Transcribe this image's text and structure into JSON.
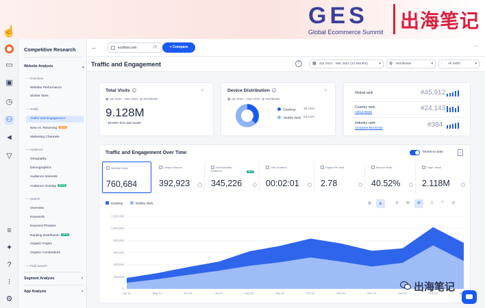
{
  "banner": {
    "ges": "GES",
    "subtitle": "Global Ecommerce Summit",
    "chinese": "出海笔记"
  },
  "sidebar": {
    "title": "Competitive Research",
    "sections": [
      {
        "label": "Website Analysis"
      },
      {
        "label": "Segment Analysis"
      },
      {
        "label": "App Analysis"
      }
    ],
    "groups": [
      "Overview",
      "Traffic",
      "Audience",
      "Search",
      "Paid Search"
    ],
    "items": {
      "website_performance": "Website Performance",
      "similar_sites": "Similar Sites",
      "traffic_engagement": "Traffic and Engagement",
      "new_returning": "New vs. Returning",
      "new_returning_badge": "NEW",
      "marketing_channels": "Marketing Channels",
      "geography": "Geography",
      "demographics": "Demographics",
      "audience_interests": "Audience Interests",
      "audience_overlap": "Audience Overlap",
      "audience_overlap_badge": "BETA",
      "search_overview": "Overview",
      "keywords": "Keywords",
      "keyword_phrases": "Keyword Phrases",
      "ranking_distribution": "Ranking Distribution",
      "ranking_badge": "NEW",
      "organic_pages": "Organic Pages",
      "organic_competitors": "Organic Competitors"
    }
  },
  "topbar": {
    "domain": "ecoflow.com",
    "compare_label": "+ Compare"
  },
  "header": {
    "title": "Traffic and Engagement",
    "date_range": "Apr 2021 - Mar 2022 (12 Months)",
    "country": "Worldwide",
    "traffic": "All traffic"
  },
  "total_visits": {
    "title": "Total Visits",
    "date": "Apr 2021 - Mar 2022",
    "country": "Worldwide",
    "value": "9.128M",
    "change_pct": "50.98%",
    "change_text": "from last month"
  },
  "device": {
    "title": "Device Distribution",
    "date": "Apr 2021 - Mar 2022",
    "country": "Worldwide",
    "desktop_label": "Desktop",
    "desktop_pct": "36.76%",
    "mobile_label": "Mobile Web",
    "mobile_pct": "63.24%",
    "desktop_fraction": 0.3676,
    "colors": {
      "desktop": "#195af2",
      "mobile": "#8fb3f7"
    }
  },
  "ranks": {
    "global_label": "Global rank",
    "global_value": "#45,912",
    "country_label": "Country rank",
    "country_sub": "United States",
    "country_value": "#24,143",
    "industry_label": "Industry rank",
    "industry_sub": "Consumer Electronics",
    "industry_value": "#384"
  },
  "traffic_card": {
    "title": "Traffic and Engagement Over Time",
    "toggle_label": "Month-to-date",
    "metrics": [
      {
        "label": "Monthly Visits",
        "value": "760,684"
      },
      {
        "label": "Unique Visitors",
        "value": "392,923"
      },
      {
        "label": "Deduplicated Audience",
        "value": "345,226",
        "badge": "NEW"
      },
      {
        "label": "Visit Duration",
        "value": "00:02:01"
      },
      {
        "label": "Pages Per Visit",
        "value": "2.78"
      },
      {
        "label": "Bounce Rate",
        "value": "40.52%"
      },
      {
        "label": "Page Views",
        "value": "2.118M"
      }
    ],
    "legend": {
      "desktop": "Desktop",
      "mobile": "Mobile Web"
    },
    "granularity": [
      "D",
      "W",
      "M"
    ]
  },
  "chart_data": {
    "type": "area",
    "stacked": true,
    "categories": [
      "Apr 21",
      "May 21",
      "Jun 21",
      "Jul 21",
      "Aug 21",
      "Sep 21",
      "Oct 21",
      "Nov 21",
      "Dec 21",
      "Jan 22",
      "Feb 22",
      "Mar 22"
    ],
    "x_tick_labels": [
      "Apr 21",
      "May 21",
      "Jun 21",
      "Jul 21",
      "Aug 21",
      "Sep 21",
      "Oct 21",
      "Nov 21",
      "Dec 21",
      "Jan 22",
      "Feb 22",
      "Mar 22"
    ],
    "y_ticks": [
      "0",
      "200,000",
      "400,000",
      "600,000",
      "800,000",
      "1,000,000",
      "1,200,000"
    ],
    "ylim": [
      0,
      1200000
    ],
    "series": [
      {
        "name": "Mobile Web",
        "values": [
          100000,
          160000,
          230000,
          300000,
          380000,
          440000,
          520000,
          450000,
          370000,
          430000,
          720000,
          460000
        ],
        "color": "#9dbcf8"
      },
      {
        "name": "Desktop",
        "values": [
          80000,
          100000,
          130000,
          150000,
          240000,
          270000,
          310000,
          300000,
          260000,
          240000,
          300000,
          300000
        ],
        "color": "#2f65ea"
      }
    ],
    "grid": true,
    "legend": "top-left"
  },
  "watermark": {
    "text": "出海笔记"
  }
}
